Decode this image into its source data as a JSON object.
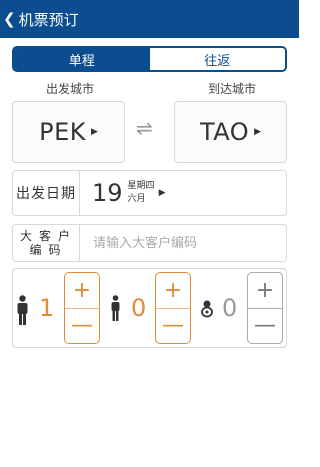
{
  "header": {
    "title": "机票预订",
    "back_icon": "chevron-left-icon"
  },
  "trip_type": {
    "tabs": [
      {
        "label": "单程",
        "active": true
      },
      {
        "label": "往返",
        "active": false
      }
    ]
  },
  "cities": {
    "departure_label": "出发城市",
    "arrival_label": "到达城市",
    "departure_code": "PEK",
    "arrival_code": "TAO",
    "swap_icon": "swap-arrows-icon"
  },
  "date": {
    "label": "出发日期",
    "day": "19",
    "weekday": "星期四",
    "month": "六月"
  },
  "client": {
    "label_line1": "大客户",
    "label_line2": "编码",
    "placeholder": "请输入大客户编码"
  },
  "passengers": {
    "adult": {
      "count": "1",
      "plus": "+",
      "minus": "—"
    },
    "child": {
      "count": "0",
      "plus": "+",
      "minus": "—"
    },
    "infant": {
      "count": "0",
      "plus": "+",
      "minus": "—"
    }
  },
  "colors": {
    "primary": "#0b4d8f",
    "accent": "#e28b38",
    "muted": "#777777"
  }
}
